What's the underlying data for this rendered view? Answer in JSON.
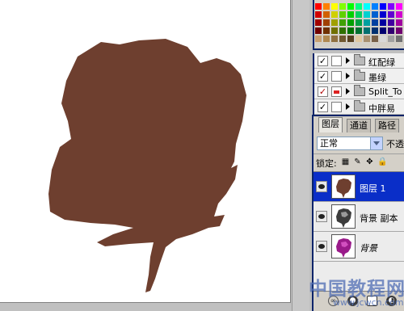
{
  "swatches": {
    "colors": [
      "#ff0000",
      "#ff8000",
      "#ffff00",
      "#80ff00",
      "#00ff00",
      "#00ff80",
      "#00ffff",
      "#0080ff",
      "#0000ff",
      "#8000ff",
      "#ff00ff",
      "#d00000",
      "#d06000",
      "#d0d000",
      "#60d000",
      "#00d000",
      "#00d060",
      "#00d0d0",
      "#0060d0",
      "#0000d0",
      "#6000d0",
      "#d000d0",
      "#a00000",
      "#a04000",
      "#a0a000",
      "#40a000",
      "#00a000",
      "#00a040",
      "#00a0a0",
      "#0040a0",
      "#0000a0",
      "#4000a0",
      "#a000a0",
      "#700000",
      "#703000",
      "#707000",
      "#307000",
      "#007000",
      "#007030",
      "#007070",
      "#003070",
      "#000070",
      "#300070",
      "#700070",
      "#c8a070",
      "#b08850",
      "#907040",
      "#705830",
      "#584020",
      "#e0c8a0",
      "#a89070",
      "#786048",
      "#d8d8d8",
      "#a0a0a0",
      "#707070"
    ]
  },
  "back_panel": {
    "rows": [
      {
        "check": "✓",
        "name": "红配绿"
      },
      {
        "check": "✓",
        "name": "墨绿"
      },
      {
        "check": "✓",
        "name": "Split_To"
      },
      {
        "check": "✓",
        "name": "中胖易"
      }
    ]
  },
  "layers_panel": {
    "tabs": [
      "图层",
      "通道",
      "路径"
    ],
    "blend_mode": "正常",
    "opacity_label": "不透",
    "lock_label": "锁定:",
    "lock_icons": [
      "▦",
      "✎",
      "✥",
      "🔒"
    ],
    "layers": [
      {
        "name": "图层 1",
        "selected": true,
        "italic": false
      },
      {
        "name": "背景 副本",
        "selected": false,
        "italic": false
      },
      {
        "name": "背景",
        "selected": false,
        "italic": true
      }
    ],
    "footer_icons": [
      "link-icon",
      "fx-icon",
      "mask-icon",
      "adjustment-icon"
    ]
  },
  "colors": {
    "silhouette": "#6e3f2f",
    "selection": "#0a2ec8",
    "panel_border": "#0a246a"
  },
  "watermark": {
    "text": "中国教程网",
    "url": "www.jcwcn.com"
  }
}
